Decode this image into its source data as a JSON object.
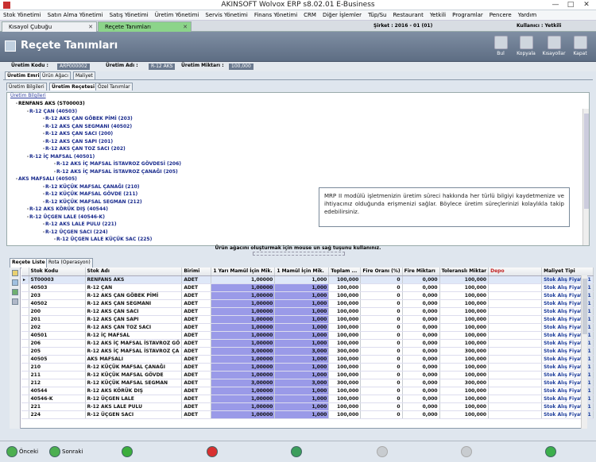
{
  "window": {
    "title": "AKINSOFT Wolvox ERP s8.02.01 E-Business",
    "minimize": "—",
    "restore": "□",
    "close": "✕"
  },
  "menu": [
    "Stok Yönetimi",
    "Satın Alma Yönetimi",
    "Satış Yönetimi",
    "Üretim Yönetimi",
    "Servis Yönetimi",
    "Finans Yönetimi",
    "CRM",
    "Diğer İşlemler",
    "Tüp/Su",
    "Restaurant",
    "Yetkili",
    "Programlar",
    "Pencere",
    "Yardım"
  ],
  "tabs": [
    {
      "label": "Kısayol Çubuğu"
    },
    {
      "label": "Reçete Tanımları"
    }
  ],
  "status": {
    "company": "Şirket : 2016 - 01 (01)",
    "user": "Kullanıcı : Yetkili"
  },
  "header": {
    "title": "Reçete Tanımları"
  },
  "toolbar": [
    "Bul",
    "Kopyala",
    "Kısayollar",
    "Kapat"
  ],
  "info": {
    "code_label": "Üretim Kodu :",
    "code_value": "ARP000002",
    "name_label": "Üretim Adı :",
    "name_value": "R-12 AKS",
    "qty_label": "Üretim Miktarı :",
    "qty_value": "100,000"
  },
  "upper_tabs": [
    "Üretim Emri",
    "Ürün Ağacı",
    "Maliyet"
  ],
  "lower_tabs": [
    "Üretim Bilgileri",
    "Üretim Reçetesi",
    "Özel Tanımlar"
  ],
  "tree_title": "Üretim Bilgileri",
  "tree": [
    {
      "text": "RENFANS AKS (ST00003)",
      "level": 0,
      "root": true
    },
    {
      "text": "R-12 ÇAN (40503)",
      "level": 1
    },
    {
      "text": "R-12 AKS ÇAN GÖBEK PİMİ (203)",
      "level": 2
    },
    {
      "text": "R-12 AKS ÇAN SEGMANI (40502)",
      "level": 2
    },
    {
      "text": "R-12 AKS ÇAN SACI (200)",
      "level": 2
    },
    {
      "text": "R-12 AKS ÇAN SAPI (201)",
      "level": 2
    },
    {
      "text": "R-12 AKS ÇAN TOZ SACI (202)",
      "level": 2
    },
    {
      "text": "R-12 İÇ MAFSAL (40501)",
      "level": 1
    },
    {
      "text": "R-12  AKS İÇ MAFSAL İSTAVROZ GÖVDESİ (206)",
      "level": 3
    },
    {
      "text": "R-12  AKS İÇ MAFSAL İSTAVROZ ÇANAĞI (205)",
      "level": 3
    },
    {
      "text": "AKS MAFSALI (40505)",
      "level": 0
    },
    {
      "text": "R-12 KÜÇÜK MAFSAL ÇANAĞI (210)",
      "level": 2
    },
    {
      "text": "R-12 KÜÇÜK MAFSAL GÖVDE (211)",
      "level": 2
    },
    {
      "text": "R-12 KÜÇÜK MAFSAL SEGMAN (212)",
      "level": 2
    },
    {
      "text": "R-12 AKS KÖRÜK DIŞ (40544)",
      "level": 1
    },
    {
      "text": "R-12 ÜÇGEN LALE (40546-K)",
      "level": 1
    },
    {
      "text": "R-12 AKS LALE PULU (221)",
      "level": 2
    },
    {
      "text": "R-12 ÜÇGEN SACI (224)",
      "level": 2
    },
    {
      "text": "R-12 ÜÇGEN LALE KÜÇÜK SAC (225)",
      "level": 3
    }
  ],
  "tooltip": "MRP II modülü işletmenizin üretim süreci hakkında her türlü bilgiyi kaydetmenize ve ihtiyacınız olduğunda erişmenizi sağlar. Böylece üretim süreçlerinizi kolaylıkla takip edebilirsiniz.",
  "tree_hint": "Ürün ağacını oluşturmak için mouse un sağ tuşunu kullanınız.",
  "grid_tabs": [
    "Reçete Liste",
    "Rota (Operasyon)"
  ],
  "columns": [
    "Stok Kodu",
    "Stok Adı",
    "Birimi",
    "1 Yarı Mamül İçin Mik.",
    "1 Mamül İçin Mik.",
    "Toplam ...",
    "Fire Oranı (%)",
    "Fire Miktarı",
    "Toleranslı Miktar",
    "Depo",
    "Maliyet Tipi"
  ],
  "rows": [
    [
      "ST00003",
      "RENFANS AKS",
      "ADET",
      "1,00000",
      "1,000",
      "100,000",
      "0",
      "0,000",
      "100,000",
      "",
      "Stok Alış Fiyatı -1"
    ],
    [
      "40503",
      "R-12 ÇAN",
      "ADET",
      "1,00000",
      "1,000",
      "100,000",
      "0",
      "0,000",
      "100,000",
      "",
      "Stok Alış Fiyatı -1"
    ],
    [
      "203",
      "R-12 AKS ÇAN GÖBEK PİMİ",
      "ADET",
      "1,00000",
      "1,000",
      "100,000",
      "0",
      "0,000",
      "100,000",
      "",
      "Stok Alış Fiyatı -1"
    ],
    [
      "40502",
      "R-12 AKS ÇAN SEGMANI",
      "ADET",
      "1,00000",
      "1,000",
      "100,000",
      "0",
      "0,000",
      "100,000",
      "",
      "Stok Alış Fiyatı -1"
    ],
    [
      "200",
      "R-12 AKS ÇAN SACI",
      "ADET",
      "1,00000",
      "1,000",
      "100,000",
      "0",
      "0,000",
      "100,000",
      "",
      "Stok Alış Fiyatı -1"
    ],
    [
      "201",
      "R-12 AKS ÇAN SAPI",
      "ADET",
      "1,00000",
      "1,000",
      "100,000",
      "0",
      "0,000",
      "100,000",
      "",
      "Stok Alış Fiyatı -1"
    ],
    [
      "202",
      "R-12 AKS ÇAN TOZ SACI",
      "ADET",
      "1,00000",
      "1,000",
      "100,000",
      "0",
      "0,000",
      "100,000",
      "",
      "Stok Alış Fiyatı -1"
    ],
    [
      "40501",
      "R-12 İÇ MAFSAL",
      "ADET",
      "1,00000",
      "1,000",
      "100,000",
      "0",
      "0,000",
      "100,000",
      "",
      "Stok Alış Fiyatı -1"
    ],
    [
      "206",
      "R-12  AKS İÇ MAFSAL İSTAVROZ GÖ",
      "ADET",
      "1,00000",
      "1,000",
      "100,000",
      "0",
      "0,000",
      "100,000",
      "",
      "Stok Alış Fiyatı -1"
    ],
    [
      "205",
      "R-12  AKS İÇ MAFSAL İSTAVROZ ÇA",
      "ADET",
      "3,00000",
      "3,000",
      "300,000",
      "0",
      "0,000",
      "300,000",
      "",
      "Stok Alış Fiyatı -1"
    ],
    [
      "40505",
      "AKS MAFSALI",
      "ADET",
      "1,00000",
      "1,000",
      "100,000",
      "0",
      "0,000",
      "100,000",
      "",
      "Stok Alış Fiyatı -1"
    ],
    [
      "210",
      "R-12 KÜÇÜK MAFSAL ÇANAĞI",
      "ADET",
      "1,00000",
      "1,000",
      "100,000",
      "0",
      "0,000",
      "100,000",
      "",
      "Stok Alış Fiyatı -1"
    ],
    [
      "211",
      "R-12 KÜÇÜK MAFSAL GÖVDE",
      "ADET",
      "1,00000",
      "1,000",
      "100,000",
      "0",
      "0,000",
      "100,000",
      "",
      "Stok Alış Fiyatı -1"
    ],
    [
      "212",
      "R-12 KÜÇÜK MAFSAL SEGMAN",
      "ADET",
      "3,00000",
      "3,000",
      "300,000",
      "0",
      "0,000",
      "300,000",
      "",
      "Stok Alış Fiyatı -1"
    ],
    [
      "40544",
      "R-12 AKS KÖRÜK DIŞ",
      "ADET",
      "1,00000",
      "1,000",
      "100,000",
      "0",
      "0,000",
      "100,000",
      "",
      "Stok Alış Fiyatı -1"
    ],
    [
      "40546-K",
      "R-12 ÜÇGEN LALE",
      "ADET",
      "1,00000",
      "1,000",
      "100,000",
      "0",
      "0,000",
      "100,000",
      "",
      "Stok Alış Fiyatı -1"
    ],
    [
      "221",
      "R-12 AKS LALE PULU",
      "ADET",
      "1,00000",
      "1,000",
      "100,000",
      "0",
      "0,000",
      "100,000",
      "",
      "Stok Alış Fiyatı -1"
    ],
    [
      "224",
      "R-12 ÜÇGEN SACI",
      "ADET",
      "1,00000",
      "1,000",
      "100,000",
      "0",
      "0,000",
      "100,000",
      "",
      "Stok Alış Fiyatı -1"
    ]
  ],
  "bottom": {
    "prev": "Önceki",
    "next": "Sonraki"
  }
}
